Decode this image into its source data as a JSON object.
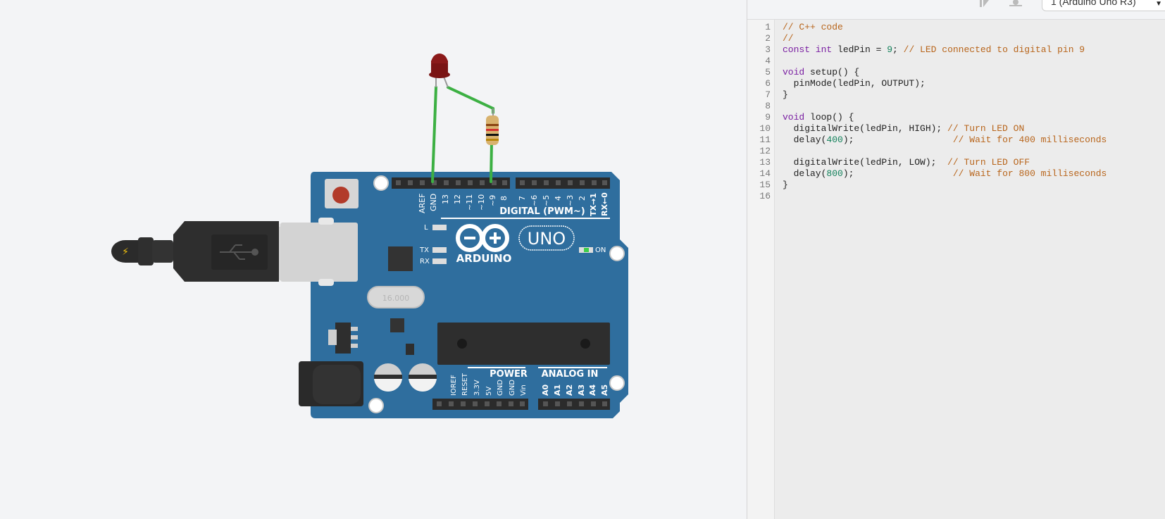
{
  "editor": {
    "board_select": "1 (Arduino Uno R3)",
    "lines": [
      {
        "num": "1",
        "parts": [
          {
            "t": "// C++ code",
            "c": "c"
          }
        ]
      },
      {
        "num": "2",
        "parts": [
          {
            "t": "//",
            "c": "c"
          }
        ]
      },
      {
        "num": "3",
        "parts": [
          {
            "t": "const int",
            "c": "k"
          },
          {
            "t": " ledPin = ",
            "c": ""
          },
          {
            "t": "9",
            "c": "n"
          },
          {
            "t": "; ",
            "c": ""
          },
          {
            "t": "// LED connected to digital pin 9",
            "c": "c"
          }
        ]
      },
      {
        "num": "4",
        "parts": []
      },
      {
        "num": "5",
        "parts": [
          {
            "t": "void",
            "c": "k"
          },
          {
            "t": " setup() {",
            "c": ""
          }
        ]
      },
      {
        "num": "6",
        "parts": [
          {
            "t": "  pinMode(ledPin, OUTPUT);",
            "c": ""
          }
        ]
      },
      {
        "num": "7",
        "parts": [
          {
            "t": "}",
            "c": ""
          }
        ]
      },
      {
        "num": "8",
        "parts": []
      },
      {
        "num": "9",
        "parts": [
          {
            "t": "void",
            "c": "k"
          },
          {
            "t": " loop() {",
            "c": ""
          }
        ]
      },
      {
        "num": "10",
        "parts": [
          {
            "t": "  digitalWrite(ledPin, HIGH); ",
            "c": ""
          },
          {
            "t": "// Turn LED ON",
            "c": "c"
          }
        ]
      },
      {
        "num": "11",
        "parts": [
          {
            "t": "  delay(",
            "c": ""
          },
          {
            "t": "400",
            "c": "n"
          },
          {
            "t": ");                  ",
            "c": ""
          },
          {
            "t": "// Wait for 400 milliseconds",
            "c": "c"
          }
        ]
      },
      {
        "num": "12",
        "parts": []
      },
      {
        "num": "13",
        "parts": [
          {
            "t": "  digitalWrite(ledPin, LOW);  ",
            "c": ""
          },
          {
            "t": "// Turn LED OFF",
            "c": "c"
          }
        ]
      },
      {
        "num": "14",
        "parts": [
          {
            "t": "  delay(",
            "c": ""
          },
          {
            "t": "800",
            "c": "n"
          },
          {
            "t": ");                  ",
            "c": ""
          },
          {
            "t": "// Wait for 800 milliseconds",
            "c": "c"
          }
        ]
      },
      {
        "num": "15",
        "parts": [
          {
            "t": "}",
            "c": ""
          }
        ]
      },
      {
        "num": "16",
        "parts": []
      }
    ]
  },
  "board": {
    "brand": "ARDUINO",
    "model": "UNO",
    "on_label": "ON",
    "l_label": "L",
    "tx_label": "TX",
    "rx_label": "RX",
    "digital_label": "DIGITAL (PWM~)",
    "power_label": "POWER",
    "analog_label": "ANALOG IN",
    "crystal_label": "16.000",
    "digital_pins_left": [
      "AREF",
      "GND",
      "13",
      "12",
      "~11",
      "~10",
      "~9",
      "8"
    ],
    "digital_pins_right": [
      "7",
      "~6",
      "~5",
      "4",
      "~3",
      "2",
      "TX→1",
      "RX←0"
    ],
    "power_pins": [
      "IOREF",
      "RESET",
      "3.3V",
      "5V",
      "GND",
      "GND",
      "Vin"
    ],
    "analog_pins": [
      "A0",
      "A1",
      "A2",
      "A3",
      "A4",
      "A5"
    ]
  },
  "colors": {
    "board_blue": "#2f6e9e",
    "wire_green": "#3cb043",
    "led_red": "#8b1a1a",
    "comment_orange": "#b8651b",
    "keyword_purple": "#7a1fa2",
    "number_green": "#13815b"
  }
}
